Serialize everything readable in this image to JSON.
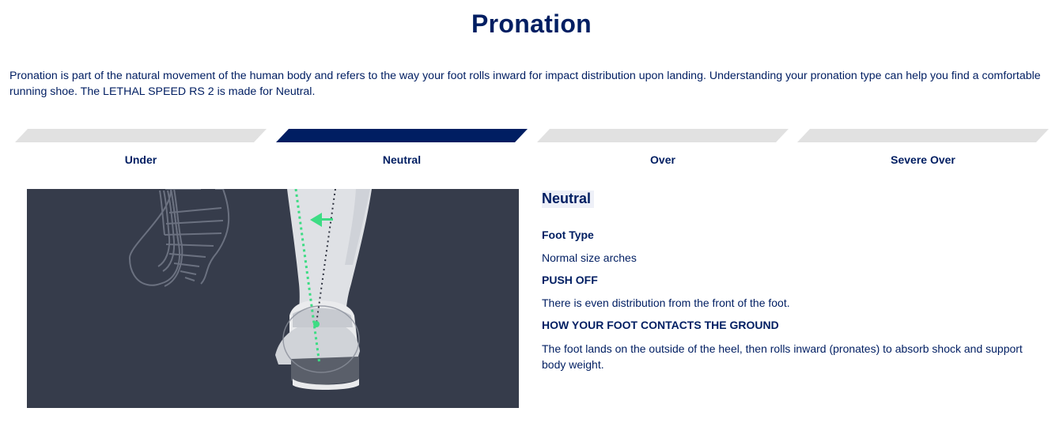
{
  "title": "Pronation",
  "intro": "Pronation is part of the natural movement of the human body and refers to the way your foot rolls inward for impact distribution upon landing. Understanding your pronation type can help you find a comfortable running shoe. The LETHAL SPEED RS 2 is made for Neutral.",
  "tabs": [
    {
      "label": "Under",
      "active": false
    },
    {
      "label": "Neutral",
      "active": true
    },
    {
      "label": "Over",
      "active": false
    },
    {
      "label": "Severe Over",
      "active": false
    }
  ],
  "details": {
    "heading": "Neutral",
    "foot_type_title": "Foot Type",
    "foot_type_text": "Normal size arches",
    "push_off_title": "PUSH OFF",
    "push_off_text": "There is even distribution from the front of the foot.",
    "contact_title": "HOW YOUR FOOT CONTACTS THE GROUND",
    "contact_text": "The foot lands on the outside of the heel, then rolls inward (pronates) to absorb shock and support body weight."
  },
  "colors": {
    "brand_navy": "#001e62",
    "tab_inactive": "#e1e1e1",
    "illustration_bg": "#363c4b",
    "indicator_green": "#3ddc84"
  },
  "illustration": {
    "icons": [
      "shoe-sole-outline",
      "leg-and-heel",
      "inward-arrow"
    ]
  }
}
